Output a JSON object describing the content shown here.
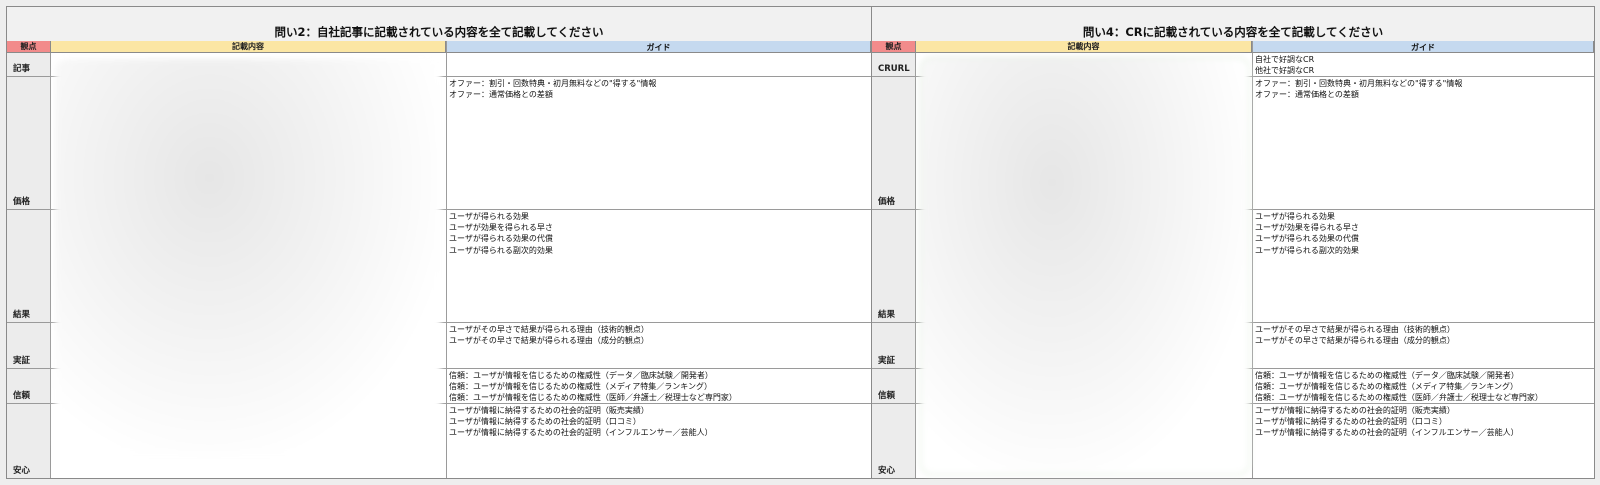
{
  "left_panel": {
    "title": "問い2：自社記事に記載されている内容を全て記載してください",
    "headers": {
      "kanten": "観点",
      "kisai": "記載内容",
      "guide": "ガイド"
    },
    "rows": [
      {
        "label": "記事",
        "guide": []
      },
      {
        "label": "価格",
        "guide": [
          "オファー：割引・回数特典・初月無料などの\"得する\"情報",
          "オファー：通常価格との差額"
        ]
      },
      {
        "label": "結果",
        "guide": [
          "ユーザが得られる効果",
          "ユーザが効果を得られる早さ",
          "ユーザが得られる効果の代償",
          "ユーザが得られる副次的効果"
        ]
      },
      {
        "label": "実証",
        "guide": [
          "ユーザがその早さで結果が得られる理由（技術的観点）",
          "ユーザがその早さで結果が得られる理由（成分的観点）"
        ]
      },
      {
        "label": "信頼",
        "guide": [
          "信頼：ユーザが情報を信じるための権威性（データ／臨床試験／開発者）",
          "信頼：ユーザが情報を信じるための権威性（メディア特集／ランキング）",
          "信頼：ユーザが情報を信じるための権威性（医師／弁護士／税理士など専門家）"
        ]
      },
      {
        "label": "安心",
        "guide": [
          "ユーザが情報に納得するための社会的証明（販売実績）",
          "ユーザが情報に納得するための社会的証明（口コミ）",
          "ユーザが情報に納得するための社会的証明（インフルエンサー／芸能人）"
        ]
      }
    ]
  },
  "right_panel": {
    "title": "問い4：CRに記載されている内容を全て記載してください",
    "headers": {
      "kanten": "観点",
      "kisai": "記載内容",
      "guide": "ガイド"
    },
    "rows": [
      {
        "label": "CRURL",
        "guide": [
          "自社で好調なCR",
          "他社で好調なCR"
        ]
      },
      {
        "label": "価格",
        "guide": [
          "オファー：割引・回数特典・初月無料などの\"得する\"情報",
          "オファー：通常価格との差額"
        ]
      },
      {
        "label": "結果",
        "guide": [
          "ユーザが得られる効果",
          "ユーザが効果を得られる早さ",
          "ユーザが得られる効果の代償",
          "ユーザが得られる副次的効果"
        ]
      },
      {
        "label": "実証",
        "guide": [
          "ユーザがその早さで結果が得られる理由（技術的観点）",
          "ユーザがその早さで結果が得られる理由（成分的観点）"
        ]
      },
      {
        "label": "信頼",
        "guide": [
          "信頼：ユーザが情報を信じるための権威性（データ／臨床試験／開発者）",
          "信頼：ユーザが情報を信じるための権威性（メディア特集／ランキング）",
          "信頼：ユーザが情報を信じるための権威性（医師／弁護士／税理士など専門家）"
        ]
      },
      {
        "label": "安心",
        "guide": [
          "ユーザが情報に納得するための社会的証明（販売実績）",
          "ユーザが情報に納得するための社会的証明（口コミ）",
          "ユーザが情報に納得するための社会的証明（インフルエンサー／芸能人）"
        ]
      }
    ]
  },
  "colors": {
    "kanten_header": "#f28b8b",
    "kisai_header": "#fbe6a4",
    "guide_header": "#c5d9ef"
  }
}
